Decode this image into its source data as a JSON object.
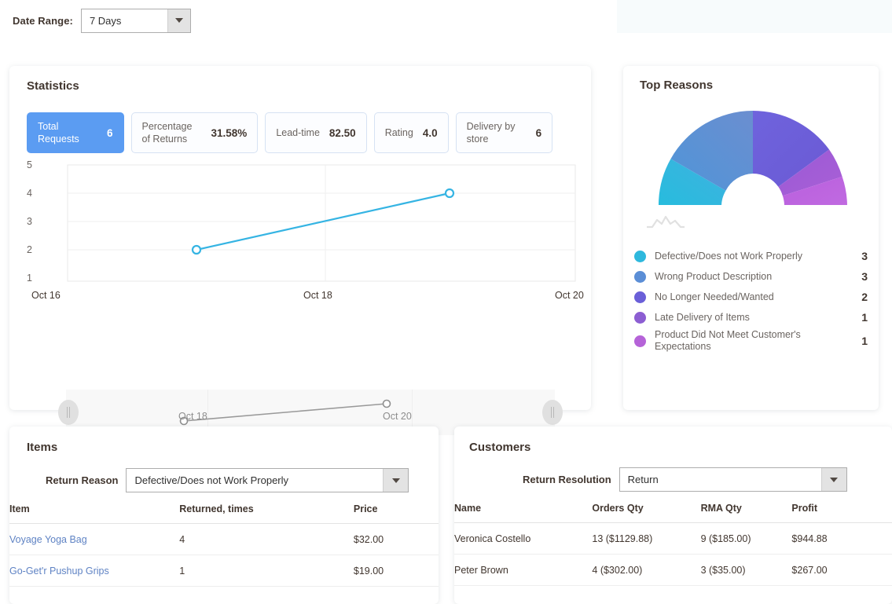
{
  "date_range": {
    "label": "Date Range:",
    "value": "7 Days"
  },
  "statistics": {
    "title": "Statistics",
    "tiles": [
      {
        "label": "Total Requests",
        "value": "6",
        "active": true
      },
      {
        "label": "Percentage of Returns",
        "value": "31.58%",
        "active": false
      },
      {
        "label": "Lead-time",
        "value": "82.50",
        "active": false
      },
      {
        "label": "Rating",
        "value": "4.0",
        "active": false
      },
      {
        "label": "Delivery by store",
        "value": "6",
        "active": false
      }
    ],
    "slider": {
      "left_handle": "range-handle-left",
      "right_handle": "range-handle-right",
      "xticks": [
        "Oct 18",
        "Oct 20"
      ]
    }
  },
  "chart_data": {
    "type": "line",
    "title": "Total Requests",
    "xlabel": "",
    "ylabel": "",
    "x": [
      "Oct 17",
      "Oct 19"
    ],
    "xtick_labels": [
      "Oct 16",
      "Oct 18",
      "Oct 20"
    ],
    "ytick_labels": [
      "1",
      "2",
      "3",
      "4",
      "5"
    ],
    "values": [
      2,
      4
    ],
    "ylim": [
      1,
      5
    ],
    "grid": true,
    "legend": "none",
    "series_color": "#35b4e3"
  },
  "top_reasons": {
    "title": "Top Reasons",
    "chart": {
      "type": "pie",
      "shape": "half-donut",
      "labels": [
        "Defective/Does not Work Properly",
        "Wrong Product Description",
        "No Longer Needed/Wanted",
        "Late Delivery of Items",
        "Product Did Not Meet Customer's Expectations"
      ],
      "values": [
        3,
        3,
        2,
        1,
        1
      ],
      "colors": [
        "#2eb8dd",
        "#5b8ed6",
        "#6a5fd8",
        "#8c5ed2",
        "#b563d8"
      ]
    },
    "legend": [
      {
        "label": "Defective/Does not Work Properly",
        "value": "3",
        "color": "#2eb8dd"
      },
      {
        "label": "Wrong Product Description",
        "value": "3",
        "color": "#5b8ed6"
      },
      {
        "label": "No Longer Needed/Wanted",
        "value": "2",
        "color": "#6a5fd8"
      },
      {
        "label": "Late Delivery of Items",
        "value": "1",
        "color": "#8c5ed2"
      },
      {
        "label": "Product Did Not Meet Customer's Expectations",
        "value": "1",
        "color": "#b563d8"
      }
    ]
  },
  "items": {
    "title": "Items",
    "filter_label": "Return Reason",
    "filter_value": "Defective/Does not Work Properly",
    "columns": [
      "Item",
      "Returned, times",
      "Price"
    ],
    "rows": [
      {
        "item": "Voyage Yoga Bag",
        "returned": "4",
        "price": "$32.00"
      },
      {
        "item": "Go-Get'r Pushup Grips",
        "returned": "1",
        "price": "$19.00"
      }
    ]
  },
  "customers": {
    "title": "Customers",
    "filter_label": "Return Resolution",
    "filter_value": "Return",
    "columns": [
      "Name",
      "Orders Qty",
      "RMA Qty",
      "Profit"
    ],
    "rows": [
      {
        "name": "Veronica Costello",
        "orders": "13 ($1129.88)",
        "rma": "9 ($185.00)",
        "profit": "$944.88"
      },
      {
        "name": "Peter Brown",
        "orders": "4 ($302.00)",
        "rma": "3 ($35.00)",
        "profit": "$267.00"
      }
    ]
  }
}
